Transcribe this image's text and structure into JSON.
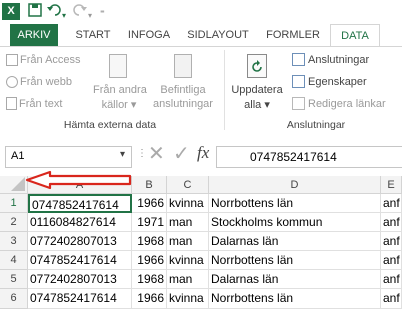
{
  "app_icon": "excel-logo",
  "qat": {
    "save_icon": "save-icon",
    "undo_icon": "undo-icon",
    "redo_icon": "redo-icon",
    "customize_icon": "customize-qat-icon"
  },
  "tabs": [
    "ARKIV",
    "START",
    "INFOGA",
    "SIDLAYOUT",
    "FORMLER",
    "DATA"
  ],
  "active_tab": "DATA",
  "ribbon": {
    "external_group": {
      "items": [
        "Från Access",
        "Från webb",
        "Från text"
      ],
      "other_sources": [
        "Från andra",
        "källor"
      ],
      "existing": [
        "Befintliga",
        "anslutningar"
      ],
      "label": "Hämta externa data"
    },
    "connections_group": {
      "refresh": [
        "Uppdatera",
        "alla"
      ],
      "items": [
        "Anslutningar",
        "Egenskaper",
        "Redigera länkar"
      ],
      "label": "Anslutningar"
    }
  },
  "formula_bar": {
    "name_box": "A1",
    "fx": "fx",
    "cancel": "✕",
    "enter": "✓",
    "value": "0747852417614"
  },
  "grid": {
    "columns": [
      "A",
      "B",
      "C",
      "D",
      "E"
    ],
    "rows": [
      {
        "n": "1",
        "a": "0747852417614",
        "b": "1966",
        "c": "kvinna",
        "d": "Norrbottens län",
        "e": "anf"
      },
      {
        "n": "2",
        "a": "0116084827614",
        "b": "1971",
        "c": "man",
        "d": "Stockholms kommun",
        "e": "anf"
      },
      {
        "n": "3",
        "a": "0772402807013",
        "b": "1968",
        "c": "man",
        "d": "Dalarnas län",
        "e": "anf"
      },
      {
        "n": "4",
        "a": "0747852417614",
        "b": "1966",
        "c": "kvinna",
        "d": "Norrbottens län",
        "e": "anf"
      },
      {
        "n": "5",
        "a": "0772402807013",
        "b": "1968",
        "c": "man",
        "d": "Dalarnas län",
        "e": "anf"
      },
      {
        "n": "6",
        "a": "0747852417614",
        "b": "1966",
        "c": "kvinna",
        "d": "Norrbottens län",
        "e": "anf"
      }
    ]
  },
  "colors": {
    "excel_green": "#217346",
    "arrow_red": "#d9261c"
  }
}
